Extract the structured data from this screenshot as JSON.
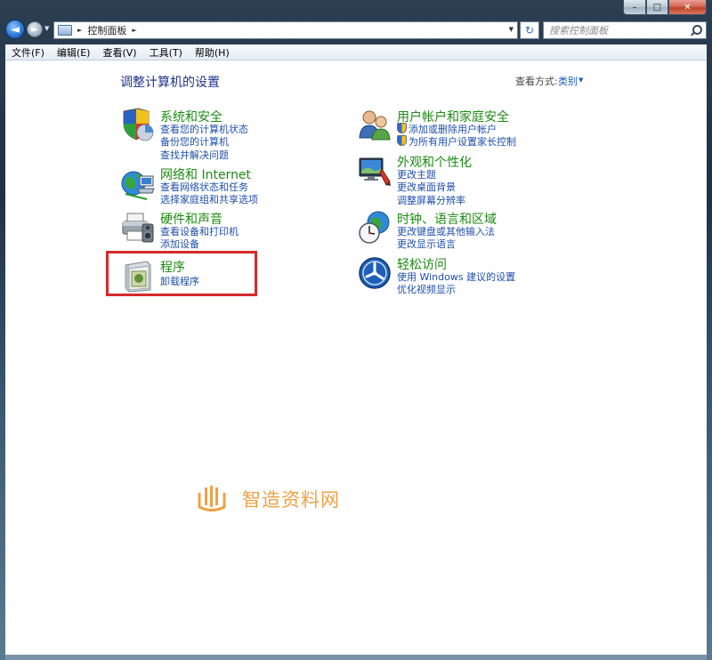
{
  "window": {
    "caption_min": "–",
    "caption_max": "□",
    "caption_close": "✕"
  },
  "navigation": {
    "back_glyph": "◄",
    "forward_glyph": "►",
    "address_path": "控制面板",
    "search_placeholder": "搜索控制面板",
    "refresh_glyph": "↻"
  },
  "menubar": {
    "items": [
      "文件(F)",
      "编辑(E)",
      "查看(V)",
      "工具(T)",
      "帮助(H)"
    ]
  },
  "main": {
    "title": "调整计算机的设置",
    "view_label": "查看方式:",
    "view_value": "类别"
  },
  "categories": {
    "system_security": {
      "title": "系统和安全",
      "icon": "shield-chart-icon",
      "links": [
        "查看您的计算机状态",
        "备份您的计算机",
        "查找并解决问题"
      ]
    },
    "network": {
      "title": "网络和 Internet",
      "icon": "globe-network-icon",
      "links": [
        "查看网络状态和任务",
        "选择家庭组和共享选项"
      ]
    },
    "hardware": {
      "title": "硬件和声音",
      "icon": "printer-speaker-icon",
      "links": [
        "查看设备和打印机",
        "添加设备"
      ]
    },
    "programs": {
      "title": "程序",
      "icon": "programs-box-icon",
      "links": [
        "卸载程序"
      ]
    },
    "user_accounts": {
      "title": "用户帐户和家庭安全",
      "icon": "users-icon",
      "links": [
        "添加或删除用户帐户",
        "为所有用户设置家长控制"
      ]
    },
    "appearance": {
      "title": "外观和个性化",
      "icon": "display-paint-icon",
      "links": [
        "更改主题",
        "更改桌面背景",
        "调整屏幕分辨率"
      ]
    },
    "clock_region": {
      "title": "时钟、语言和区域",
      "icon": "clock-globe-icon",
      "links": [
        "更改键盘或其他输入法",
        "更改显示语言"
      ]
    },
    "ease_access": {
      "title": "轻松访问",
      "icon": "ease-of-access-icon",
      "links": [
        "使用 Windows 建议的设置",
        "优化视频显示"
      ]
    }
  },
  "watermark": {
    "text": "智造资料网",
    "color": "#f0a046"
  }
}
